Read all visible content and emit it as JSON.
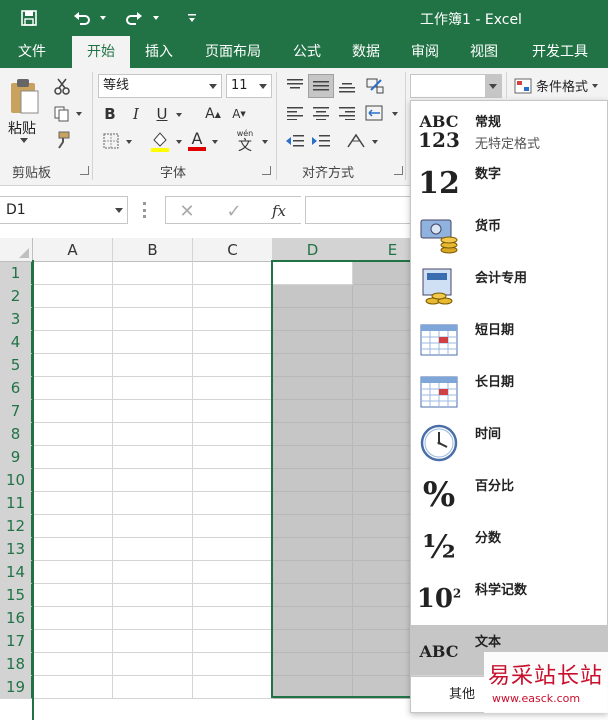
{
  "window": {
    "title": "工作簿1 - Excel"
  },
  "tabs": [
    "文件",
    "开始",
    "插入",
    "页面布局",
    "公式",
    "数据",
    "审阅",
    "视图",
    "开发工具"
  ],
  "active_tab": "开始",
  "ribbon": {
    "clipboard": {
      "label": "剪贴板",
      "paste_label": "粘贴"
    },
    "font": {
      "label": "字体",
      "name": "等线",
      "size": "11",
      "bold": "B",
      "italic": "I",
      "underline": "U",
      "grow": "A",
      "shrink": "A",
      "phonetic": "wén",
      "phonetic_char": "文"
    },
    "alignment": {
      "label": "对齐方式"
    },
    "number": {
      "format_value": "",
      "conditional_label": "条件格式"
    }
  },
  "name_box": {
    "value": "D1"
  },
  "formula_bar": {
    "fx": "fx",
    "value": ""
  },
  "columns": [
    "A",
    "B",
    "C",
    "D",
    "E"
  ],
  "rows": [
    "1",
    "2",
    "3",
    "4",
    "5",
    "6",
    "7",
    "8",
    "9",
    "10",
    "11",
    "12",
    "13",
    "14",
    "15",
    "16",
    "17",
    "18",
    "19"
  ],
  "number_formats": [
    {
      "name": "常规",
      "sub": "无特定格式",
      "icon": "abc-123-icon",
      "glyph1": "ABC",
      "glyph2": "123"
    },
    {
      "name": "数字",
      "sub": "",
      "icon": "number-icon",
      "glyph1": "12"
    },
    {
      "name": "货币",
      "sub": "",
      "icon": "currency-icon"
    },
    {
      "name": "会计专用",
      "sub": "",
      "icon": "accounting-icon"
    },
    {
      "name": "短日期",
      "sub": "",
      "icon": "calendar-icon"
    },
    {
      "name": "长日期",
      "sub": "",
      "icon": "calendar-icon"
    },
    {
      "name": "时间",
      "sub": "",
      "icon": "clock-icon"
    },
    {
      "name": "百分比",
      "sub": "",
      "icon": "percent-icon",
      "glyph1": "%"
    },
    {
      "name": "分数",
      "sub": "",
      "icon": "fraction-icon",
      "glyph1": "½"
    },
    {
      "name": "科学记数",
      "sub": "",
      "icon": "scientific-icon",
      "glyph1": "10",
      "glyph2": "2"
    },
    {
      "name": "文本",
      "sub": "",
      "icon": "text-abc-icon",
      "glyph1": "ABC"
    }
  ],
  "more_formats": "其他",
  "watermark": {
    "line1": "易采站长站",
    "line2": "www.easck.com"
  },
  "colors": {
    "accent": "#217346",
    "selection": "#d3d3d3",
    "highlight": "#c6c6c6"
  }
}
